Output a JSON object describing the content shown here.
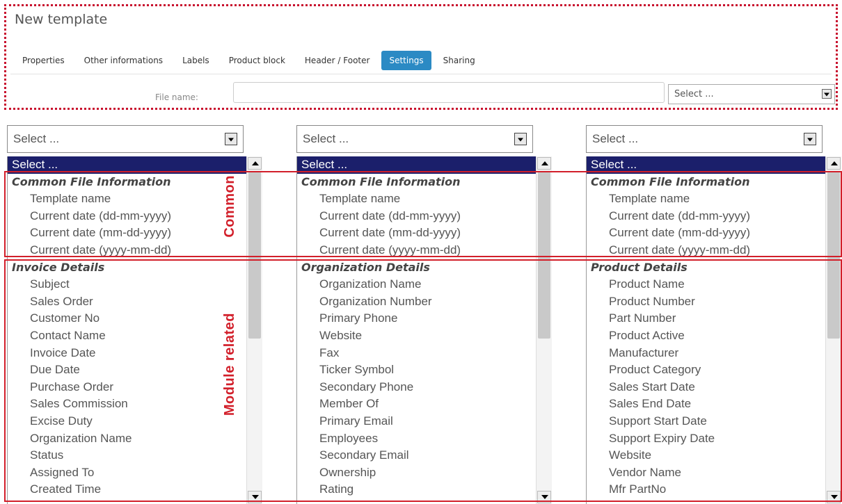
{
  "header": {
    "title": "New template",
    "tabs": [
      {
        "label": "Properties",
        "active": false
      },
      {
        "label": "Other informations",
        "active": false
      },
      {
        "label": "Labels",
        "active": false
      },
      {
        "label": "Product block",
        "active": false
      },
      {
        "label": "Header / Footer",
        "active": false
      },
      {
        "label": "Settings",
        "active": true
      },
      {
        "label": "Sharing",
        "active": false
      }
    ],
    "file_name_label": "File name:",
    "file_name_value": "",
    "file_select_value": "Select ..."
  },
  "columns": [
    {
      "select_value": "Select ...",
      "options": {
        "selected": "Select ...",
        "common_group": "Common File Information",
        "common_items": [
          "Template name",
          "Current date (dd-mm-yyyy)",
          "Current date (mm-dd-yyyy)",
          "Current date (yyyy-mm-dd)"
        ],
        "module_group": "Invoice Details",
        "module_items": [
          "Subject",
          "Sales Order",
          "Customer No",
          "Contact Name",
          "Invoice Date",
          "Due Date",
          "Purchase Order",
          "Sales Commission",
          "Excise Duty",
          "Organization Name",
          "Status",
          "Assigned To",
          "Created Time"
        ]
      }
    },
    {
      "select_value": "Select ...",
      "options": {
        "selected": "Select ...",
        "common_group": "Common File Information",
        "common_items": [
          "Template name",
          "Current date (dd-mm-yyyy)",
          "Current date (mm-dd-yyyy)",
          "Current date (yyyy-mm-dd)"
        ],
        "module_group": "Organization Details",
        "module_items": [
          "Organization Name",
          "Organization Number",
          "Primary Phone",
          "Website",
          "Fax",
          "Ticker Symbol",
          "Secondary Phone",
          "Member Of",
          "Primary Email",
          "Employees",
          "Secondary Email",
          "Ownership",
          "Rating"
        ]
      }
    },
    {
      "select_value": "Select ...",
      "options": {
        "selected": "Select ...",
        "common_group": "Common File Information",
        "common_items": [
          "Template name",
          "Current date (dd-mm-yyyy)",
          "Current date (mm-dd-yyyy)",
          "Current date (yyyy-mm-dd)"
        ],
        "module_group": "Product Details",
        "module_items": [
          "Product Name",
          "Product Number",
          "Part Number",
          "Product Active",
          "Manufacturer",
          "Product Category",
          "Sales Start Date",
          "Sales End Date",
          "Support Start Date",
          "Support Expiry Date",
          "Website",
          "Vendor Name",
          "Mfr PartNo"
        ]
      }
    }
  ],
  "annotations": {
    "common_label": "Common",
    "module_label": "Module related",
    "color": "#d21f2a"
  }
}
